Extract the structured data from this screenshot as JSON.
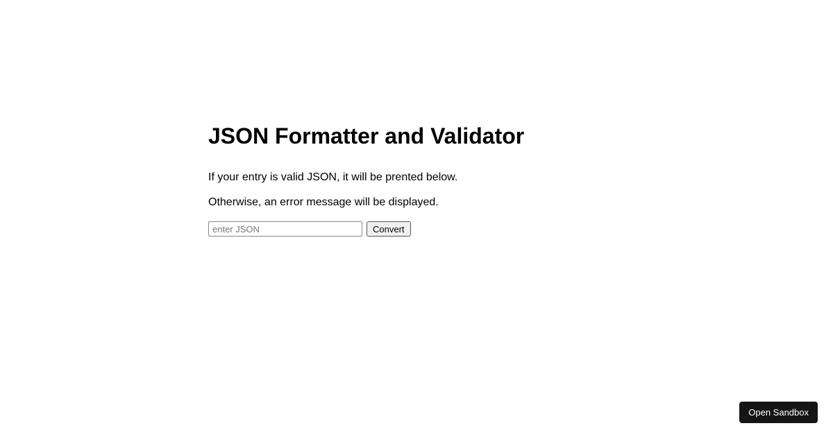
{
  "main": {
    "title": "JSON Formatter and Validator",
    "description_line1": "If your entry is valid JSON, it will be prented below.",
    "description_line2": "Otherwise, an error message will be displayed.",
    "input_placeholder": "enter JSON",
    "input_value": "",
    "convert_label": "Convert"
  },
  "footer": {
    "sandbox_label": "Open Sandbox"
  }
}
